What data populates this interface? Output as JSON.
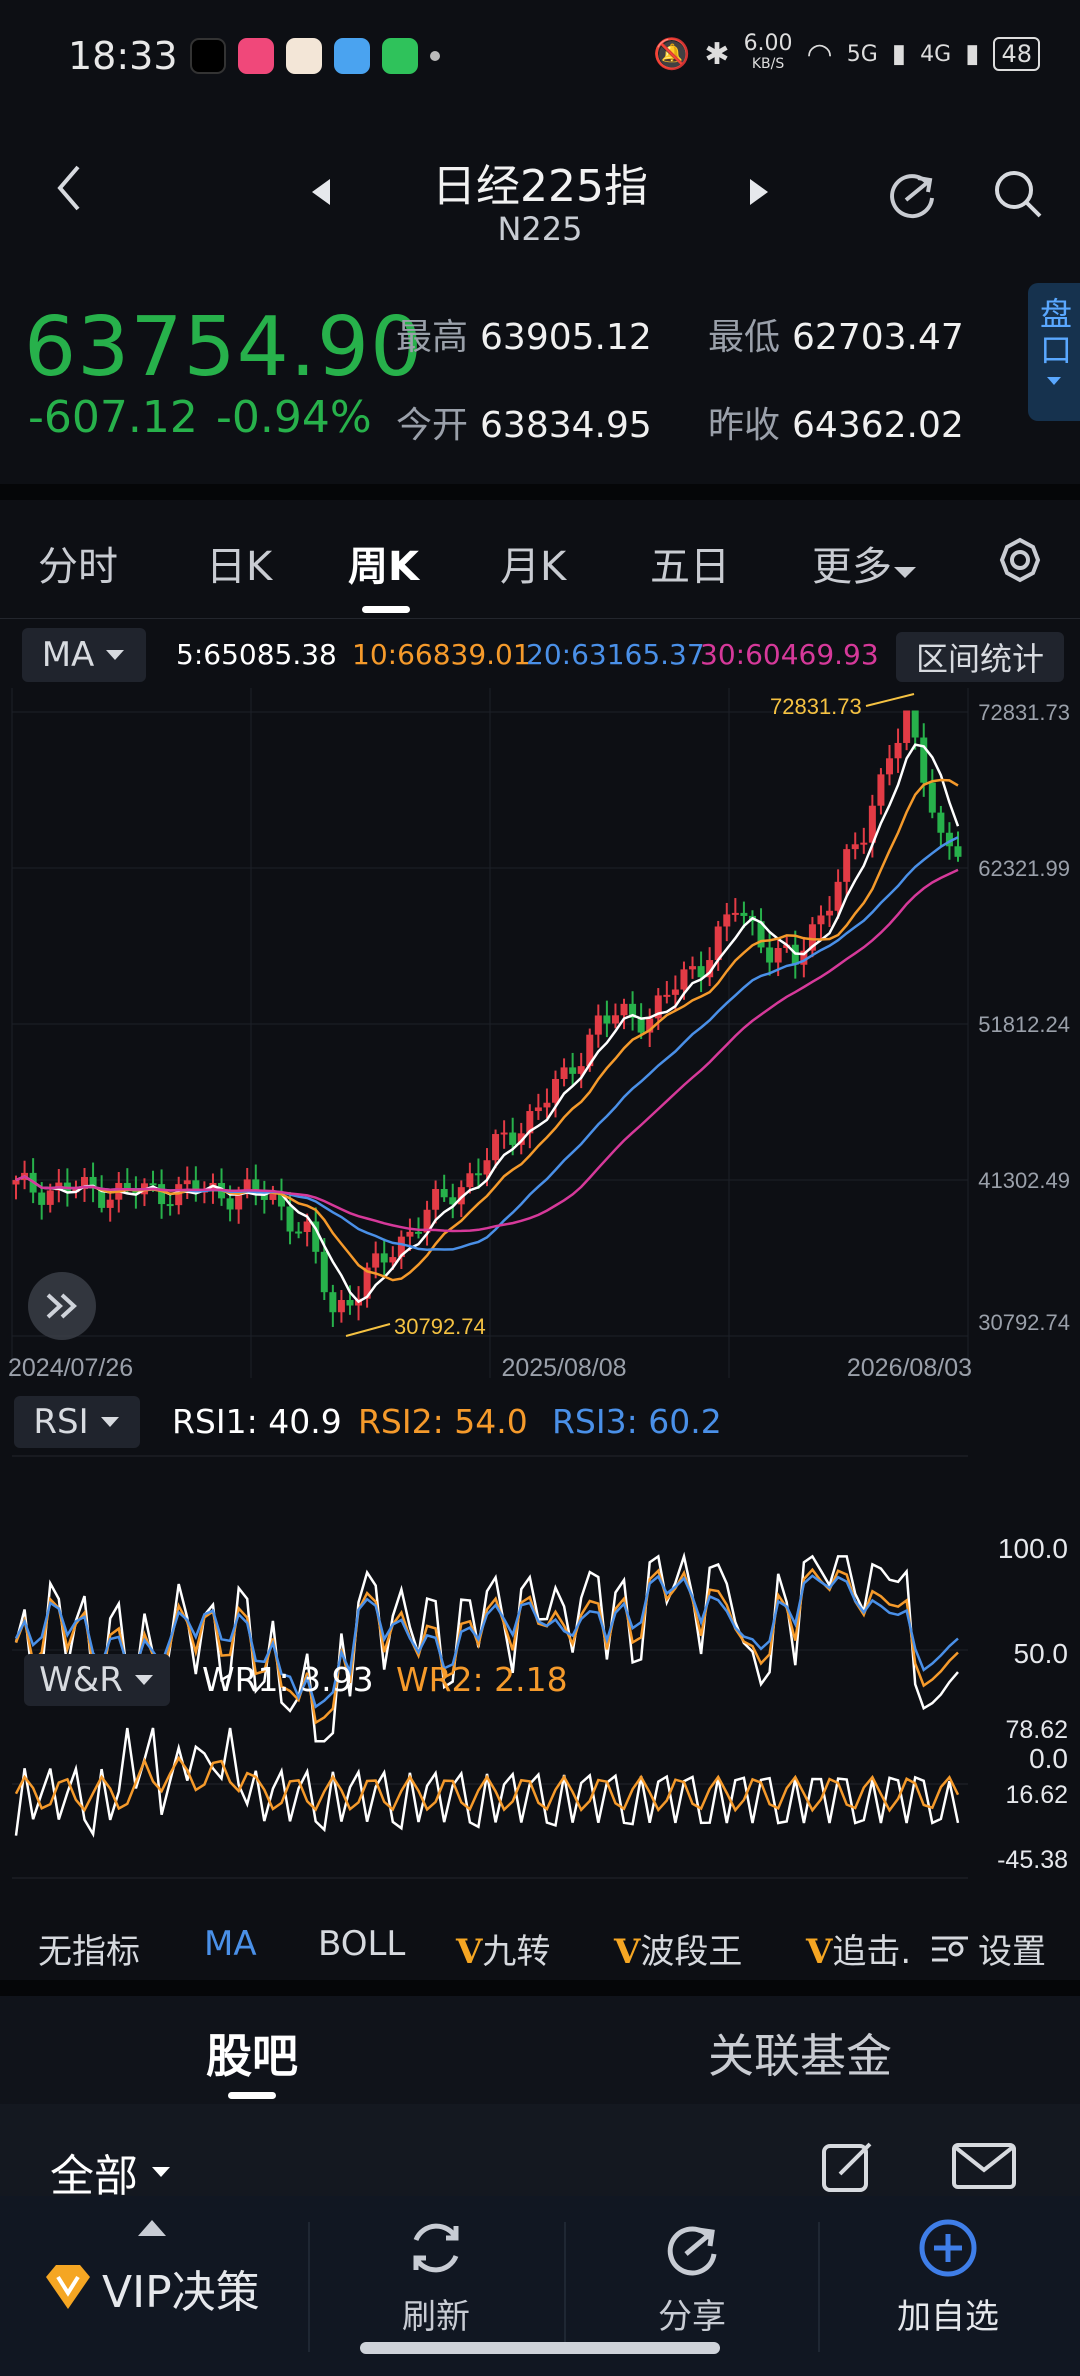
{
  "status_bar": {
    "time": "18:33",
    "net_speed": "6.00",
    "net_unit": "KB/S",
    "signal1": "5G",
    "signal2": "4G",
    "battery": "48"
  },
  "header": {
    "title": "日经225指",
    "subtitle": "N225"
  },
  "quote": {
    "price": "63754.90",
    "change": "-607.12",
    "change_pct": "-0.94%",
    "high_label": "最高",
    "high": "63905.12",
    "low_label": "最低",
    "low": "62703.47",
    "open_label": "今开",
    "open": "63834.95",
    "prev_label": "昨收",
    "prev": "64362.02",
    "side_tab": "盘口",
    "colors": {
      "down": "#27b14b",
      "up": "#e23b45"
    }
  },
  "tabs": [
    "分时",
    "日K",
    "周K",
    "月K",
    "五日",
    "更多"
  ],
  "active_tab": "周K",
  "ma": {
    "selector": "MA",
    "ma5": "5:65085.38",
    "ma10": "10:66839.01",
    "ma20": "20:63165.37",
    "ma30": "30:60469.93",
    "range_button": "区间统计",
    "colors": {
      "ma5": "#ffffff",
      "ma10": "#f59a2b",
      "ma20": "#4a90e8",
      "ma30": "#d6399a"
    }
  },
  "kline": {
    "y_ticks": [
      "72831.73",
      "62321.99",
      "51812.24",
      "41302.49",
      "30792.74"
    ],
    "x_ticks": [
      "2024/07/26",
      "2025/08/08",
      "2026/08/03"
    ],
    "max_label": "72831.73",
    "min_label": "30792.74"
  },
  "rsi": {
    "selector": "RSI",
    "rsi1": "RSI1: 40.9",
    "rsi2": "RSI2: 54.0",
    "rsi3": "RSI3: 60.2",
    "y_ticks": [
      "100.0",
      "50.0",
      "0.0"
    ]
  },
  "wr": {
    "selector": "W&R",
    "wr1": "WR1: 3.93",
    "wr2": "WR2: 2.18",
    "y_ticks": [
      "78.62",
      "16.62",
      "-45.38"
    ]
  },
  "indicator_bar": {
    "items": [
      "无指标",
      "MA",
      "BOLL",
      "九转",
      "波段王",
      "追击."
    ],
    "settings": "设置"
  },
  "guba": {
    "tab1": "股吧",
    "tab2": "关联基金",
    "filter": "全部"
  },
  "bottom_nav": {
    "vip": "VIP决策",
    "refresh": "刷新",
    "share": "分享",
    "watch": "加自选"
  }
}
